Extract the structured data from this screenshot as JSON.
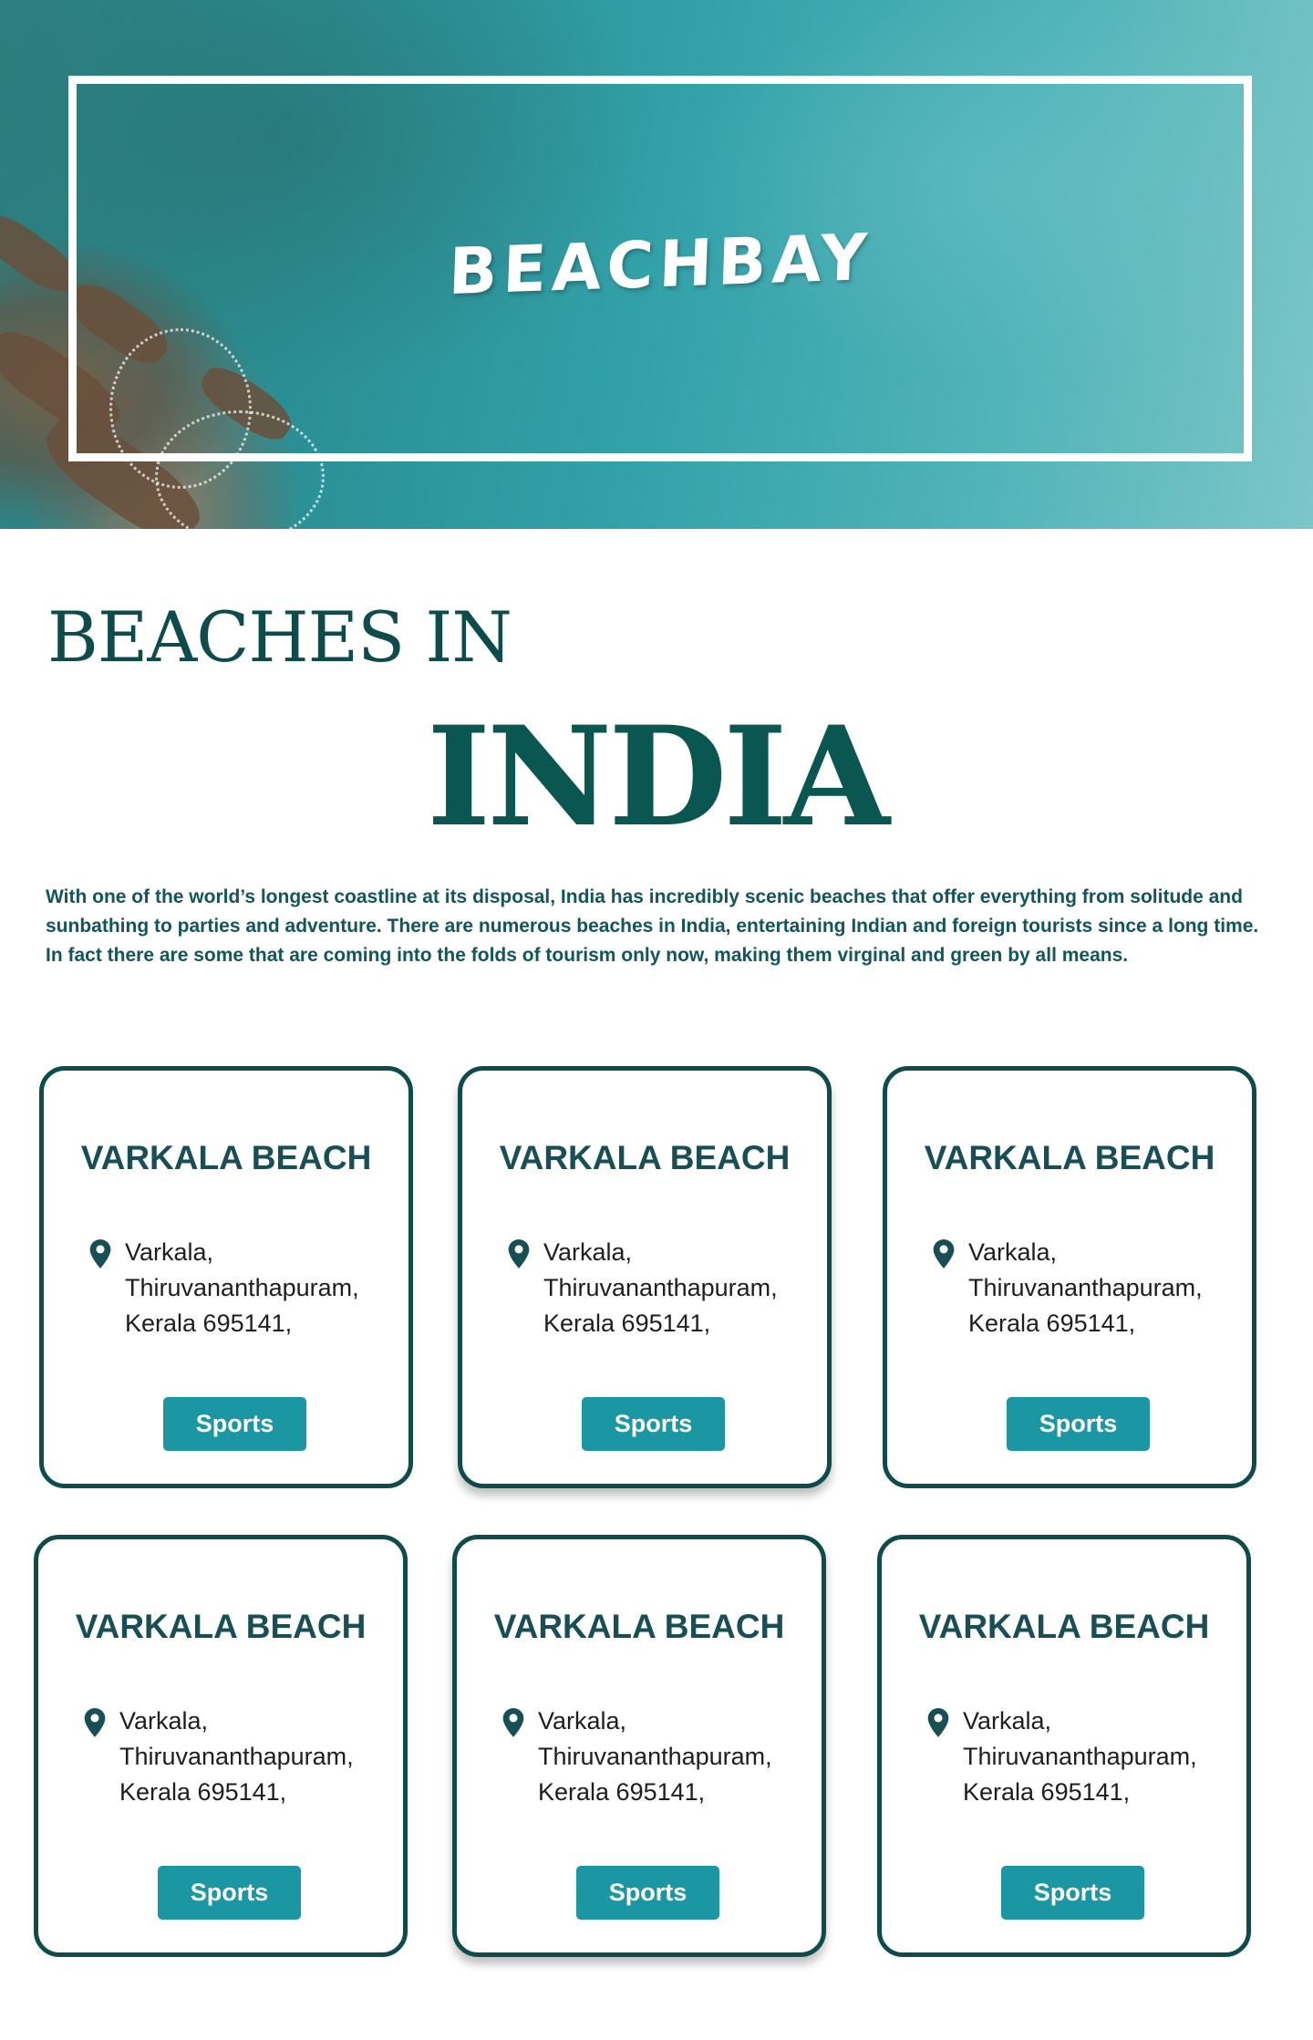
{
  "hero": {
    "brand": "BEACHBAY"
  },
  "section": {
    "heading_small": "BEACHES IN",
    "heading_big": "INDIA",
    "intro": "With one of the world’s longest coastline at its disposal, India has incredibly scenic beaches that offer everything from solitude and sunbathing to parties and adventure. There are numerous beaches in India, entertaining Indian and foreign tourists since a long time. In fact there are some that are coming into the folds of tourism only now, making them virginal and green by all means."
  },
  "cards": [
    {
      "title": "VARKALA BEACH",
      "address": [
        "Varkala,",
        "Thiruvananthapuram,",
        "Kerala 695141,"
      ],
      "button": "Sports"
    },
    {
      "title": "VARKALA BEACH",
      "address": [
        "Varkala,",
        "Thiruvananthapuram,",
        "Kerala 695141,"
      ],
      "button": "Sports"
    },
    {
      "title": "VARKALA BEACH",
      "address": [
        "Varkala,",
        "Thiruvananthapuram,",
        "Kerala 695141,"
      ],
      "button": "Sports"
    },
    {
      "title": "VARKALA BEACH",
      "address": [
        "Varkala,",
        "Thiruvananthapuram,",
        "Kerala 695141,"
      ],
      "button": "Sports"
    },
    {
      "title": "VARKALA BEACH",
      "address": [
        "Varkala,",
        "Thiruvananthapuram,",
        "Kerala 695141,"
      ],
      "button": "Sports"
    },
    {
      "title": "VARKALA BEACH",
      "address": [
        "Varkala,",
        "Thiruvananthapuram,",
        "Kerala 695141,"
      ],
      "button": "Sports"
    }
  ],
  "icons": {
    "location": "map-pin-icon"
  },
  "colors": {
    "primary_dark": "#0e4c4c",
    "accent": "#1a97a3",
    "text": "#1e1e1e",
    "background": "#ffffff"
  }
}
